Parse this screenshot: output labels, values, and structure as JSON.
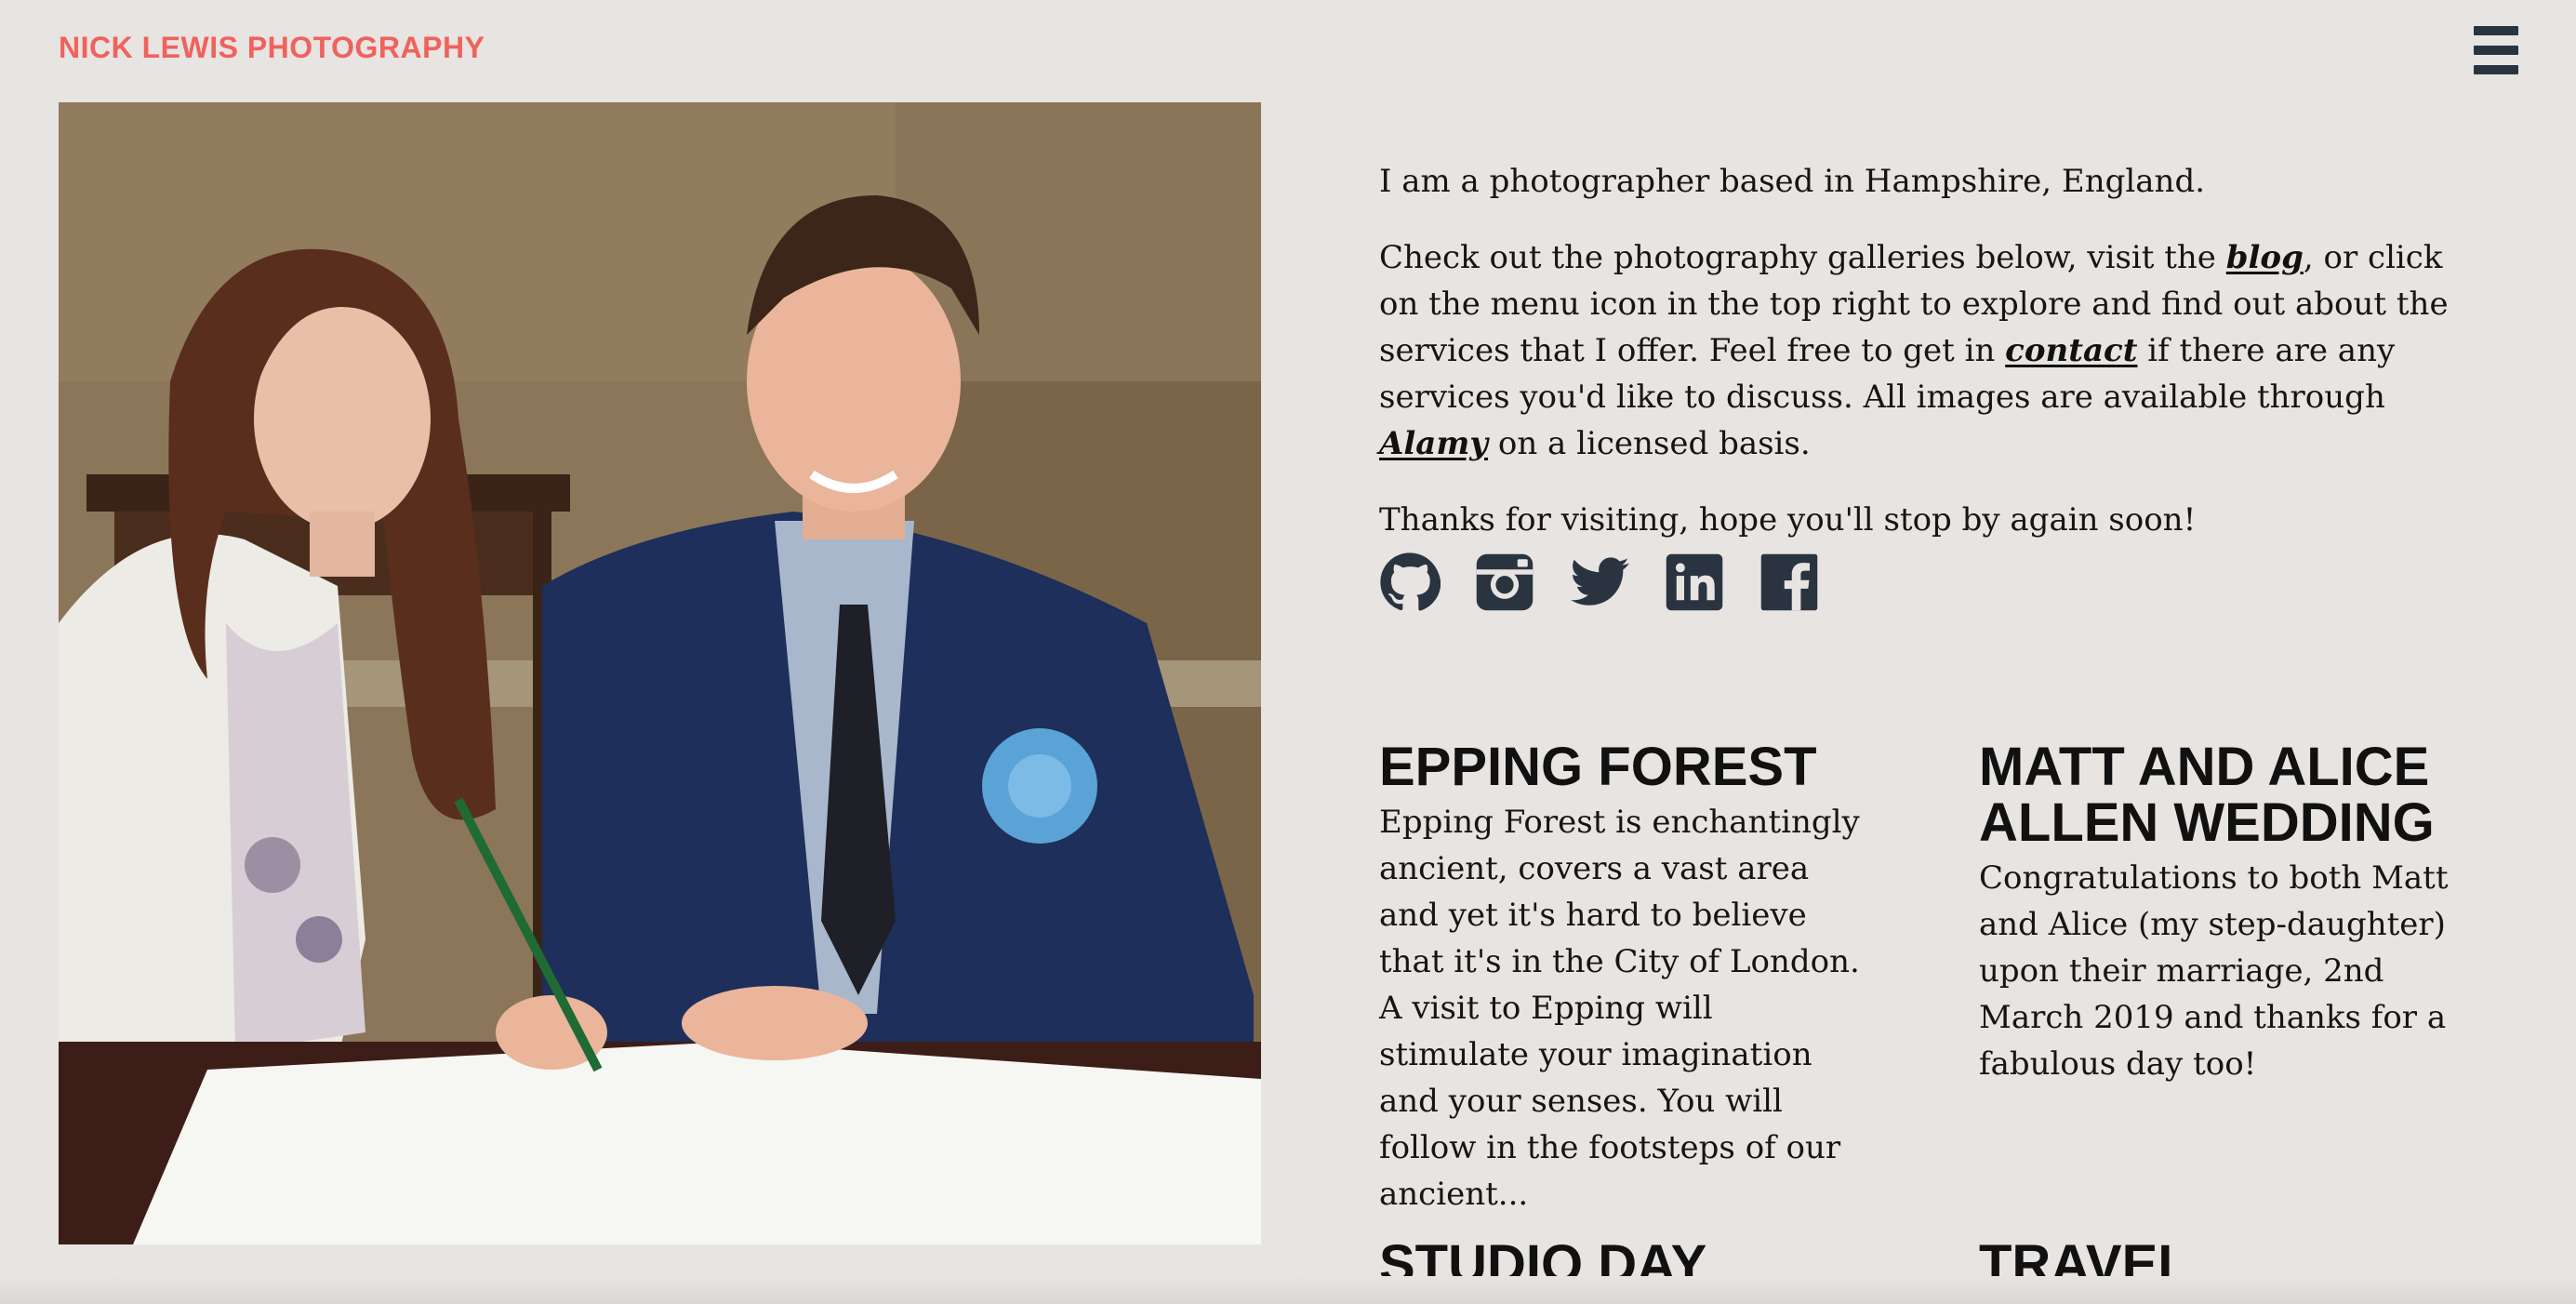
{
  "header": {
    "site_title": "NICK LEWIS PHOTOGRAPHY",
    "menu_icon": "hamburger-menu-icon"
  },
  "hero": {
    "photo_subject": "couple-signing-register"
  },
  "intro": {
    "line1": "I am a photographer based in Hampshire, England.",
    "p2_part1": "Check out the photography galleries below, visit the ",
    "blog_link": "blog",
    "p2_part2": ", or click on the menu icon in the top right to explore and find out about the services that I offer. Feel free to get in ",
    "contact_link": "contact",
    "p2_part3": " if there are any services you'd like to discuss. All images are available through ",
    "alamy_link": "Alamy",
    "p2_part4": " on a licensed basis.",
    "line3": "Thanks for visiting, hope you'll stop by again soon!"
  },
  "social": {
    "icons": [
      "github-icon",
      "instagram-icon",
      "twitter-icon",
      "linkedin-icon",
      "facebook-icon"
    ],
    "icon_color": "#2a3440"
  },
  "galleries": [
    {
      "title": "EPPING FOREST",
      "description": "Epping Forest is enchantingly ancient, covers a vast area and yet it's hard to believe that it's in the City of London. A visit to Epping will stimulate your imagination and your senses. You will follow in the footsteps of our ancient..."
    },
    {
      "title": "MATT AND ALICE ALLEN WEDDING",
      "description": "Congratulations to both Matt and Alice (my step-daughter) upon their marriage, 2nd March 2019 and thanks for a fabulous day too!"
    },
    {
      "title": "STUDIO DAY",
      "description": ""
    },
    {
      "title": "TRAVEL",
      "description": ""
    }
  ],
  "colors": {
    "background": "#e7e4e1",
    "brand": "#f0625d",
    "text": "#151515"
  }
}
